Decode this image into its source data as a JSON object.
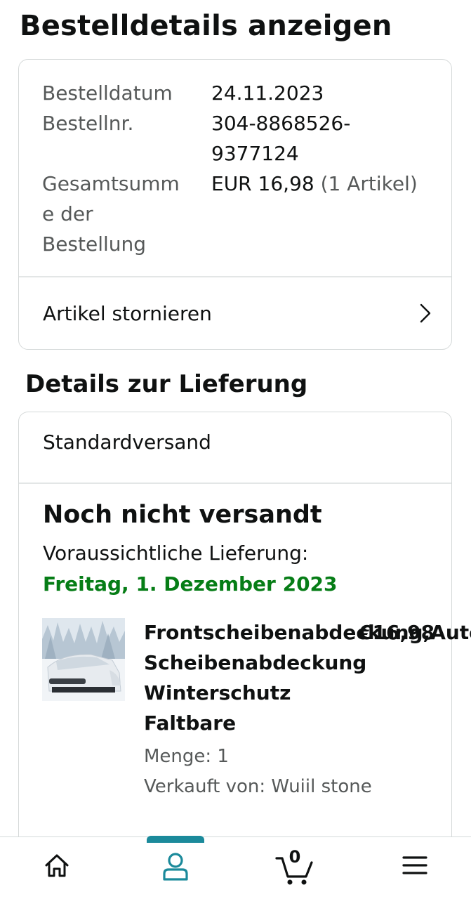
{
  "page": {
    "title": "Bestelldetails anzeigen"
  },
  "order_summary": {
    "date_label": "Bestelldatum",
    "date_value": "24.11.2023",
    "number_label": "Bestellnr.",
    "number_value_line1": "304-8868526-",
    "number_value_line2": "9377124",
    "total_label_line1": "Gesamtsumm",
    "total_label_line2": "e der",
    "total_label_line3": "Bestellung",
    "total_amount": "EUR 16,98",
    "total_items": "(1 Artikel)",
    "cancel_label": "Artikel stornieren"
  },
  "delivery": {
    "section_title": "Details zur Lieferung",
    "shipping_method": "Standardversand",
    "status": "Noch nicht versandt",
    "estimate_label": "Voraussichtliche Lieferung:",
    "estimate_date": "Freitag, 1. Dezember 2023",
    "estimate_color": "#067d16",
    "product": {
      "title_line1": "Frontscheibenabdeckung,Auto",
      "title_line2": "Scheibenabdeckung",
      "title_line3": "Winterschutz",
      "title_line4": "Faltbare",
      "price": "€16,98",
      "quantity": "Menge: 1",
      "seller": "Verkauft von: Wuiil stone"
    }
  },
  "bottom_nav": {
    "items": [
      {
        "name": "home",
        "icon": "home-icon"
      },
      {
        "name": "account",
        "icon": "person-icon",
        "active": true
      },
      {
        "name": "cart",
        "icon": "cart-icon",
        "count": "0"
      },
      {
        "name": "menu",
        "icon": "hamburger-menu-icon"
      }
    ],
    "active_color": "#1b8a9b"
  }
}
